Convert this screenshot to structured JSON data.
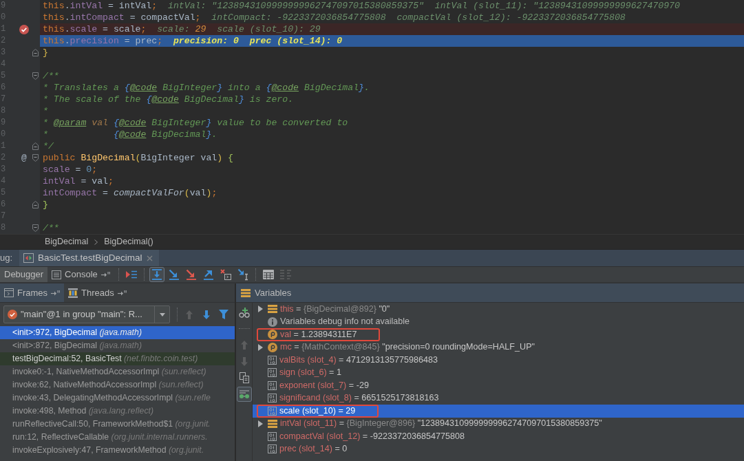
{
  "editor": {
    "lines": [
      {
        "number": "9",
        "kind": "plain",
        "tokens": [
          {
            "text": "        this",
            "kind": "kw"
          },
          {
            "text": ".",
            "kind": "plain"
          },
          {
            "text": "intVal",
            "kind": "field"
          },
          {
            "text": " = intVal",
            "kind": "plain"
          },
          {
            "text": ";",
            "kind": "semi"
          }
        ],
        "inline_values": [
          {
            "text": "intVal: \"1238943109999999962747097015380859375\"  intVal (slot_11): \"12389431099999999627470970",
            "kind": "hint"
          }
        ]
      },
      {
        "number": "0",
        "kind": "plain",
        "tokens": [
          {
            "text": "        this",
            "kind": "kw"
          },
          {
            "text": ".",
            "kind": "plain"
          },
          {
            "text": "intCompact",
            "kind": "field"
          },
          {
            "text": " = compactVal",
            "kind": "plain"
          },
          {
            "text": ";",
            "kind": "semi"
          }
        ],
        "inline_values": [
          {
            "text": "intCompact: -9223372036854775808  compactVal (slot_12): -9223372036854775808",
            "kind": "hint"
          }
        ]
      },
      {
        "number": "1",
        "kind": "breakpoint",
        "tokens": [
          {
            "text": "        this",
            "kind": "kw"
          },
          {
            "text": ".",
            "kind": "plain"
          },
          {
            "text": "scale",
            "kind": "field"
          },
          {
            "text": " = scale",
            "kind": "plain"
          },
          {
            "text": ";",
            "kind": "semi"
          }
        ],
        "inline_values": [
          {
            "text": "scale: ",
            "kind": "hint"
          },
          {
            "text": "29",
            "kind": "changed"
          },
          {
            "text": "  scale (slot_10): 29",
            "kind": "hint"
          }
        ]
      },
      {
        "number": "2",
        "kind": "execution",
        "tokens": [
          {
            "text": "        this",
            "kind": "kw"
          },
          {
            "text": ".",
            "kind": "plain"
          },
          {
            "text": "precision",
            "kind": "field"
          },
          {
            "text": " = prec",
            "kind": "plain"
          },
          {
            "text": ";",
            "kind": "semi"
          }
        ],
        "inline_values": [
          {
            "text": "precision: 0  prec (slot_14): 0",
            "kind": "current"
          }
        ]
      },
      {
        "number": "3",
        "kind": "plain",
        "fold": {
          "kind": "end"
        },
        "tokens": [
          {
            "text": "    }",
            "kind": "br1"
          }
        ]
      },
      {
        "number": "4",
        "kind": "plain"
      },
      {
        "number": "5",
        "kind": "plain",
        "fold": {
          "kind": "start"
        },
        "tokens": [
          {
            "text": "    /**",
            "kind": "doc"
          }
        ]
      },
      {
        "number": "6",
        "kind": "plain",
        "tokens": [
          {
            "text": "     * Translates a ",
            "kind": "doc"
          },
          {
            "text": "{",
            "kind": "docbrace"
          },
          {
            "text": "@code",
            "kind": "doctag"
          },
          {
            "text": " BigInteger",
            "kind": "doc"
          },
          {
            "text": "}",
            "kind": "docbrace"
          },
          {
            "text": " into a ",
            "kind": "doc"
          },
          {
            "text": "{",
            "kind": "docbrace"
          },
          {
            "text": "@code",
            "kind": "doctag"
          },
          {
            "text": " BigDecimal",
            "kind": "doc"
          },
          {
            "text": "}",
            "kind": "docbrace"
          },
          {
            "text": ".",
            "kind": "doc"
          }
        ]
      },
      {
        "number": "7",
        "kind": "plain",
        "tokens": [
          {
            "text": "     * The scale of the ",
            "kind": "doc"
          },
          {
            "text": "{",
            "kind": "docbrace"
          },
          {
            "text": "@code",
            "kind": "doctag"
          },
          {
            "text": " BigDecimal",
            "kind": "doc"
          },
          {
            "text": "}",
            "kind": "docbrace"
          },
          {
            "text": " is zero.",
            "kind": "doc"
          }
        ]
      },
      {
        "number": "8",
        "kind": "plain",
        "tokens": [
          {
            "text": "     *",
            "kind": "doc"
          }
        ]
      },
      {
        "number": "9",
        "kind": "plain",
        "tokens": [
          {
            "text": "     * ",
            "kind": "doc"
          },
          {
            "text": "@param",
            "kind": "doctag"
          },
          {
            "text": " val ",
            "kind": "docparam"
          },
          {
            "text": "{",
            "kind": "docbrace"
          },
          {
            "text": "@code",
            "kind": "doctag"
          },
          {
            "text": " BigInteger",
            "kind": "doc"
          },
          {
            "text": "}",
            "kind": "docbrace"
          },
          {
            "text": " value to be converted to",
            "kind": "doc"
          }
        ]
      },
      {
        "number": "0",
        "kind": "plain",
        "tokens": [
          {
            "text": "     *            ",
            "kind": "doc"
          },
          {
            "text": "{",
            "kind": "docbrace"
          },
          {
            "text": "@code",
            "kind": "doctag"
          },
          {
            "text": " BigDecimal",
            "kind": "doc"
          },
          {
            "text": "}",
            "kind": "docbrace"
          },
          {
            "text": ".",
            "kind": "doc"
          }
        ]
      },
      {
        "number": "1",
        "kind": "plain",
        "fold": {
          "kind": "end"
        },
        "tokens": [
          {
            "text": "     */",
            "kind": "doc"
          }
        ]
      },
      {
        "number": "2",
        "kind": "plain",
        "gutter_mark": "@",
        "fold": {
          "kind": "start"
        },
        "tokens": [
          {
            "text": "    public ",
            "kind": "kw"
          },
          {
            "text": "BigDecimal",
            "kind": "decl"
          },
          {
            "text": "(",
            "kind": "br1"
          },
          {
            "text": "BigInteger val",
            "kind": "plain"
          },
          {
            "text": ")",
            "kind": "br1"
          },
          {
            "text": " {",
            "kind": "br2"
          }
        ]
      },
      {
        "number": "3",
        "kind": "plain",
        "tokens": [
          {
            "text": "        scale",
            "kind": "field"
          },
          {
            "text": " = ",
            "kind": "plain"
          },
          {
            "text": "0",
            "kind": "num"
          },
          {
            "text": ";",
            "kind": "semi"
          }
        ]
      },
      {
        "number": "4",
        "kind": "plain",
        "tokens": [
          {
            "text": "        intVal",
            "kind": "field"
          },
          {
            "text": " = val",
            "kind": "plain"
          },
          {
            "text": ";",
            "kind": "semi"
          }
        ]
      },
      {
        "number": "5",
        "kind": "plain",
        "tokens": [
          {
            "text": "        intCompact",
            "kind": "field"
          },
          {
            "text": " = ",
            "kind": "plain"
          },
          {
            "text": "compactValFor",
            "kind": "call"
          },
          {
            "text": "(",
            "kind": "br1"
          },
          {
            "text": "val",
            "kind": "plain"
          },
          {
            "text": ")",
            "kind": "br1"
          },
          {
            "text": ";",
            "kind": "semi"
          }
        ]
      },
      {
        "number": "6",
        "kind": "plain",
        "fold": {
          "kind": "end"
        },
        "tokens": [
          {
            "text": "    }",
            "kind": "br2"
          }
        ]
      },
      {
        "number": "7",
        "kind": "plain"
      },
      {
        "number": "8",
        "kind": "plain",
        "fold": {
          "kind": "start"
        },
        "tokens": [
          {
            "text": "    /**",
            "kind": "doc"
          }
        ]
      }
    ]
  },
  "breadcrumbs": [
    "BigDecimal",
    "BigDecimal()"
  ],
  "debug_window": {
    "label": "ug:",
    "tabs": [
      {
        "title": "BasicTest.testBigDecimal",
        "selected": true
      }
    ]
  },
  "toolbar": {
    "tabs": [
      {
        "kind": "debugger",
        "label": "Debugger",
        "selected": true,
        "pin": false
      },
      {
        "kind": "console",
        "label": "Console",
        "selected": false,
        "pin": true
      }
    ],
    "actions": [
      {
        "kind": "separator"
      },
      {
        "kind": "execution-point",
        "active": false,
        "disabled": false
      },
      {
        "kind": "separator"
      },
      {
        "kind": "step-over",
        "active": true,
        "disabled": false
      },
      {
        "kind": "step-into",
        "active": false,
        "disabled": false
      },
      {
        "kind": "force-step-into",
        "active": false,
        "disabled": false
      },
      {
        "kind": "step-out",
        "active": false,
        "disabled": false
      },
      {
        "kind": "drop-frame",
        "active": false,
        "disabled": false
      },
      {
        "kind": "run-to-cursor",
        "active": false,
        "disabled": false
      },
      {
        "kind": "separator"
      },
      {
        "kind": "evaluate",
        "active": false,
        "disabled": false
      },
      {
        "kind": "trace",
        "active": false,
        "disabled": true
      }
    ]
  },
  "frames_panel": {
    "tabs": [
      {
        "kind": "frames",
        "label": "Frames",
        "selected": true,
        "pin": true
      },
      {
        "kind": "threads",
        "label": "Threads",
        "selected": false,
        "pin": true
      }
    ],
    "thread": "\"main\"@1 in group \"main\": R...",
    "actions": [
      {
        "kind": "up",
        "disabled": true
      },
      {
        "kind": "down",
        "disabled": false
      },
      {
        "kind": "filter",
        "disabled": false
      }
    ],
    "frames": [
      {
        "method": "<init>:972, BigDecimal",
        "package": "(java.math)",
        "kind": "library",
        "selected": true
      },
      {
        "method": "<init>:872, BigDecimal",
        "package": "(java.math)",
        "kind": "library",
        "selected": false
      },
      {
        "method": "testBigDecimal:52, BasicTest",
        "package": "(net.finbtc.coin.test)",
        "kind": "project",
        "selected": false
      },
      {
        "method": "invoke0:-1, NativeMethodAccessorImpl",
        "package": "(sun.reflect)",
        "kind": "library",
        "selected": false
      },
      {
        "method": "invoke:62, NativeMethodAccessorImpl",
        "package": "(sun.reflect)",
        "kind": "library",
        "selected": false
      },
      {
        "method": "invoke:43, DelegatingMethodAccessorImpl",
        "package": "(sun.refle",
        "kind": "library",
        "selected": false
      },
      {
        "method": "invoke:498, Method",
        "package": "(java.lang.reflect)",
        "kind": "library",
        "selected": false
      },
      {
        "method": "runReflectiveCall:50, FrameworkMethod$1",
        "package": "(org.junit.",
        "kind": "library",
        "selected": false
      },
      {
        "method": "run:12, ReflectiveCallable",
        "package": "(org.junit.internal.runners.",
        "kind": "library",
        "selected": false
      },
      {
        "method": "invokeExplosively:47, FrameworkMethod",
        "package": "(org.junit.",
        "kind": "library",
        "selected": false
      }
    ]
  },
  "variables_panel": {
    "title": "Variables",
    "actions": [
      {
        "kind": "add-watch",
        "active": false,
        "disabled": false
      },
      {
        "kind": "separator"
      },
      {
        "kind": "up",
        "active": false,
        "disabled": true
      },
      {
        "kind": "down",
        "active": false,
        "disabled": true
      },
      {
        "kind": "copy",
        "active": false,
        "disabled": false
      },
      {
        "kind": "watches",
        "active": true,
        "disabled": false
      }
    ],
    "variables": [
      {
        "kind": "object",
        "expandable": true,
        "selected": false,
        "outlined": false,
        "name": "this",
        "sep": "=",
        "ref": "{BigDecimal@892}",
        "value": "\"0\""
      },
      {
        "kind": "info",
        "expandable": false,
        "selected": false,
        "outlined": false,
        "message": "Variables debug info not available"
      },
      {
        "kind": "param",
        "expandable": false,
        "selected": false,
        "outlined": true,
        "name": "val",
        "sep": "=",
        "value": "1.23894311E7"
      },
      {
        "kind": "param",
        "expandable": true,
        "selected": false,
        "outlined": false,
        "name": "mc",
        "sep": "=",
        "ref": "{MathContext@845}",
        "value": "\"precision=0 roundingMode=HALF_UP\""
      },
      {
        "kind": "primitive",
        "expandable": false,
        "selected": false,
        "outlined": false,
        "name": "valBits (slot_4)",
        "sep": "=",
        "value": "4712913135775986483"
      },
      {
        "kind": "primitive",
        "expandable": false,
        "selected": false,
        "outlined": false,
        "name": "sign (slot_6)",
        "sep": "=",
        "value": "1"
      },
      {
        "kind": "primitive",
        "expandable": false,
        "selected": false,
        "outlined": false,
        "name": "exponent (slot_7)",
        "sep": "=",
        "value": "-29"
      },
      {
        "kind": "primitive",
        "expandable": false,
        "selected": false,
        "outlined": false,
        "name": "significand (slot_8)",
        "sep": "=",
        "value": "6651525173818163"
      },
      {
        "kind": "primitive",
        "expandable": false,
        "selected": true,
        "outlined": true,
        "name": "scale (slot_10)",
        "sep": "=",
        "value": "29"
      },
      {
        "kind": "object",
        "expandable": true,
        "selected": false,
        "outlined": false,
        "name": "intVal (slot_11)",
        "sep": "=",
        "ref": "{BigInteger@896}",
        "value": "\"1238943109999999962747097015380859375\""
      },
      {
        "kind": "primitive",
        "expandable": false,
        "selected": false,
        "outlined": false,
        "name": "compactVal (slot_12)",
        "sep": "=",
        "value": "-9223372036854775808"
      },
      {
        "kind": "primitive",
        "expandable": false,
        "selected": false,
        "outlined": false,
        "name": "prec (slot_14)",
        "sep": "=",
        "value": "0"
      }
    ]
  }
}
